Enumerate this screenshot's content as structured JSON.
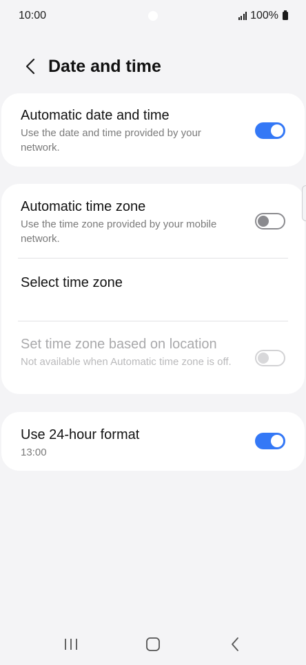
{
  "status_bar": {
    "time": "10:00",
    "battery": "100%",
    "signal_icon": "signal-bars-icon",
    "battery_icon": "battery-icon"
  },
  "header": {
    "back_icon": "chevron-left-icon",
    "title": "Date and time"
  },
  "accent_color": "#3478f6",
  "settings": {
    "auto_date_time": {
      "title": "Automatic date and time",
      "subtitle": "Use the date and time provided by your network.",
      "enabled": true
    },
    "auto_time_zone": {
      "title": "Automatic time zone",
      "subtitle": "Use the time zone provided by your mobile network.",
      "enabled": false
    },
    "select_time_zone": {
      "title": "Select time zone"
    },
    "location_time_zone": {
      "title": "Set time zone based on location",
      "subtitle": "Not available when Automatic time zone is off.",
      "enabled": false,
      "available": false
    },
    "use_24_hour": {
      "title": "Use 24-hour format",
      "subtitle": "13:00",
      "enabled": true
    }
  },
  "nav_bar": {
    "recents_icon": "recents-icon",
    "home_icon": "home-icon",
    "back_icon": "back-icon"
  }
}
